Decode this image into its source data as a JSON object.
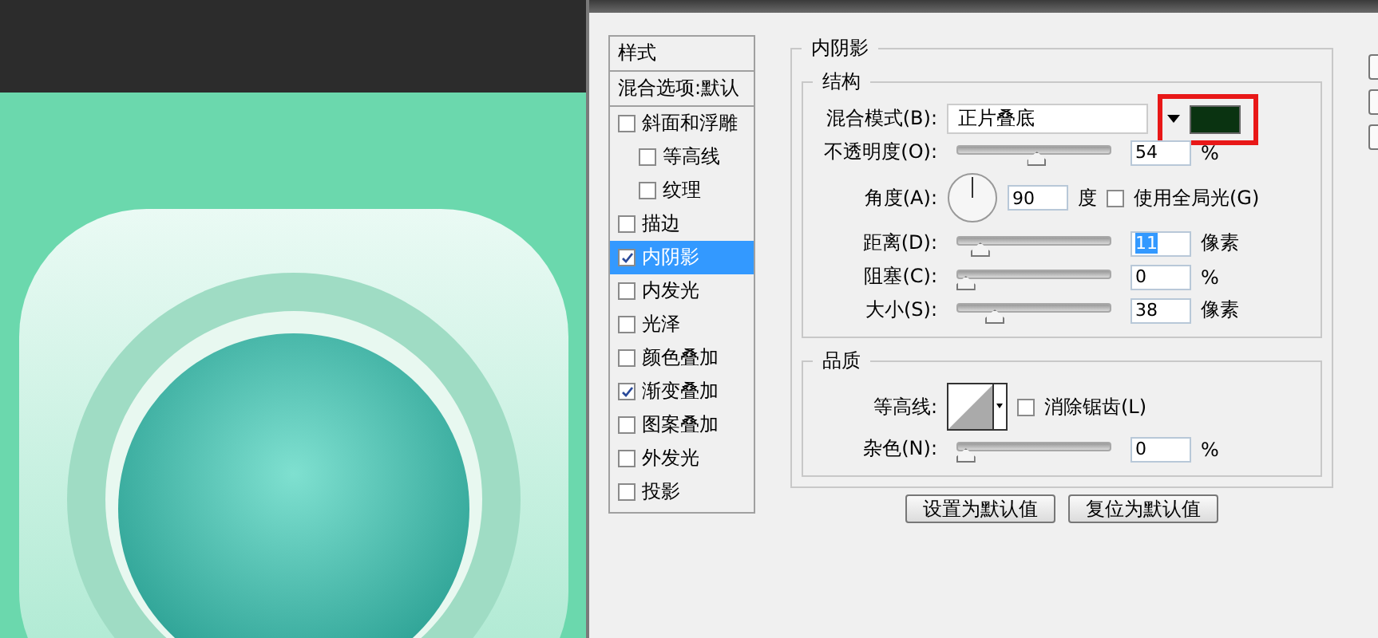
{
  "styles_panel": {
    "header": "样式",
    "blending_options": "混合选项:默认",
    "items": [
      {
        "label": "斜面和浮雕",
        "checked": false,
        "selected": false,
        "children": [
          {
            "label": "等高线",
            "checked": false,
            "selected": false
          },
          {
            "label": "纹理",
            "checked": false,
            "selected": false
          }
        ]
      },
      {
        "label": "描边",
        "checked": false,
        "selected": false
      },
      {
        "label": "内阴影",
        "checked": true,
        "selected": true
      },
      {
        "label": "内发光",
        "checked": false,
        "selected": false
      },
      {
        "label": "光泽",
        "checked": false,
        "selected": false
      },
      {
        "label": "颜色叠加",
        "checked": false,
        "selected": false
      },
      {
        "label": "渐变叠加",
        "checked": true,
        "selected": false
      },
      {
        "label": "图案叠加",
        "checked": false,
        "selected": false
      },
      {
        "label": "外发光",
        "checked": false,
        "selected": false
      },
      {
        "label": "投影",
        "checked": false,
        "selected": false
      }
    ]
  },
  "inner_shadow": {
    "title": "内阴影",
    "structure": {
      "title": "结构",
      "blend_mode": {
        "label": "混合模式(B):",
        "value": "正片叠底",
        "color": "#0a3311",
        "highlighted": true
      },
      "opacity": {
        "label": "不透明度(O):",
        "level": 0.54,
        "value": "54",
        "unit": "%"
      },
      "angle": {
        "label": "角度(A):",
        "value": "90",
        "unit": "度",
        "global_light": {
          "label": "使用全局光(G)",
          "checked": false
        }
      },
      "sliders": [
        {
          "label": "距离(D):",
          "level": 0.11,
          "value": "11",
          "unit": "像素",
          "selected": true
        },
        {
          "label": "阻塞(C):",
          "level": 0,
          "value": "0",
          "unit": "%",
          "selected": false
        },
        {
          "label": "大小(S):",
          "level": 0.22,
          "value": "38",
          "unit": "像素",
          "selected": false
        }
      ]
    },
    "quality": {
      "title": "品质",
      "contour_label": "等高线:",
      "anti_alias": {
        "label": "消除锯齿(L)",
        "checked": false
      },
      "noise": {
        "label": "杂色(N):",
        "level": 0,
        "value": "0",
        "unit": "%"
      }
    },
    "buttons": [
      "设置为默认值",
      "复位为默认值"
    ]
  }
}
